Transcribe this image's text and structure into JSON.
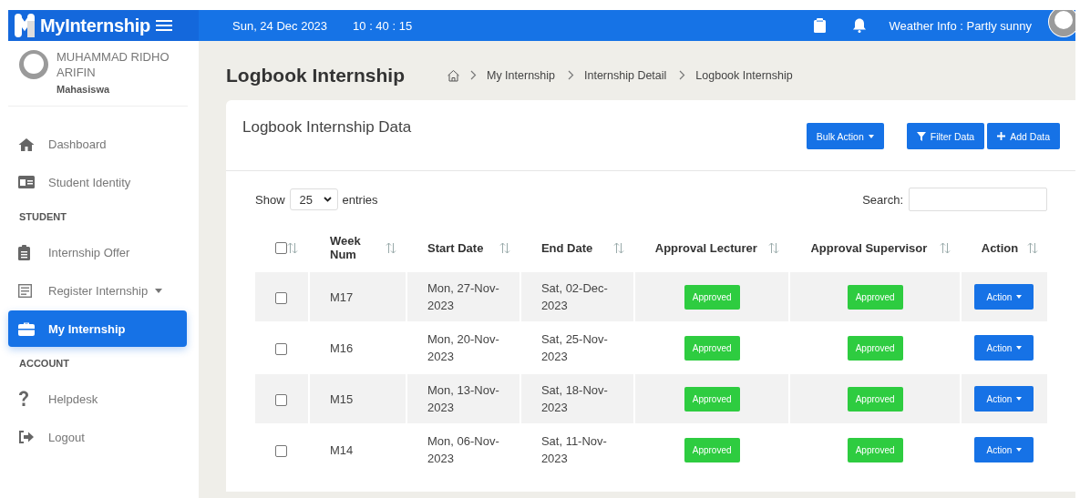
{
  "header": {
    "brand": "MyInternship",
    "date": "Sun, 24 Dec 2023",
    "time": "10 : 40 : 15",
    "weather": "Weather Info : Partly sunny"
  },
  "user": {
    "name": "MUHAMMAD RIDHO ARIFIN",
    "role": "Mahasiswa"
  },
  "sidebar": {
    "items": [
      {
        "kind": "item",
        "label": "Dashboard",
        "selected": false
      },
      {
        "kind": "item",
        "label": "Student Identity",
        "selected": false
      },
      {
        "kind": "section",
        "label": "STUDENT"
      },
      {
        "kind": "item",
        "label": "Internship Offer",
        "selected": false
      },
      {
        "kind": "dropdown",
        "label": "Register Internship",
        "selected": false
      },
      {
        "kind": "item",
        "label": "My Internship",
        "selected": true
      },
      {
        "kind": "section",
        "label": "ACCOUNT"
      },
      {
        "kind": "item",
        "label": "Helpdesk",
        "selected": false
      },
      {
        "kind": "item",
        "label": "Logout",
        "selected": false
      }
    ]
  },
  "page": {
    "title": "Logbook Internship",
    "breadcrumb": [
      "My Internship",
      "Internship Detail",
      "Logbook Internship"
    ]
  },
  "card": {
    "title": "Logbook Internship Data",
    "buttons": [
      {
        "kind": "dropdown",
        "label": "Bulk Action"
      },
      {
        "kind": "filter",
        "label": "Filter Data"
      },
      {
        "kind": "add",
        "label": "Add Data"
      }
    ]
  },
  "table": {
    "show_label": "Show",
    "page_size": "25",
    "entries_label": "entries",
    "search_label": "Search:",
    "select_all_checked": false,
    "columns": [
      "Week Num",
      "Start Date",
      "End Date",
      "Approval Lecturer",
      "Approval Supervisor",
      "Action"
    ],
    "rows": [
      {
        "checked": false,
        "week": "M17",
        "start_date": "Mon, 27-Nov-2023",
        "end_date": "Sat, 02-Dec-2023",
        "approval_lecturer": "Approved",
        "approval_supervisor": "Approved",
        "action": "Action"
      },
      {
        "checked": false,
        "week": "M16",
        "start_date": "Mon, 20-Nov-2023",
        "end_date": "Sat, 25-Nov-2023",
        "approval_lecturer": "Approved",
        "approval_supervisor": "Approved",
        "action": "Action"
      },
      {
        "checked": false,
        "week": "M15",
        "start_date": "Mon, 13-Nov-2023",
        "end_date": "Sat, 18-Nov-2023",
        "approval_lecturer": "Approved",
        "approval_supervisor": "Approved",
        "action": "Action"
      },
      {
        "checked": false,
        "week": "M14",
        "start_date": "Mon, 06-Nov-2023",
        "end_date": "Sat, 11-Nov-2023",
        "approval_lecturer": "Approved",
        "approval_supervisor": "Approved",
        "action": "Action"
      }
    ]
  }
}
